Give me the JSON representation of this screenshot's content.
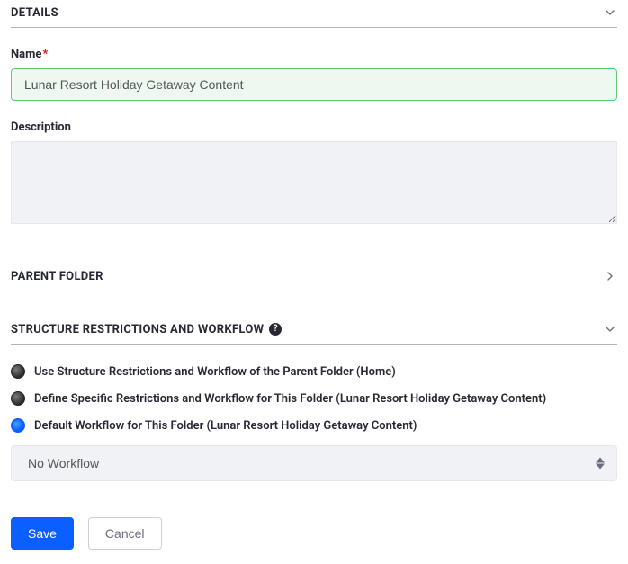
{
  "sections": {
    "details": {
      "title": "DETAILS",
      "expanded": true
    },
    "parent_folder": {
      "title": "PARENT FOLDER",
      "expanded": false
    },
    "structure_restrictions": {
      "title": "STRUCTURE RESTRICTIONS AND WORKFLOW",
      "expanded": true,
      "help": "?"
    }
  },
  "fields": {
    "name": {
      "label": "Name",
      "required_mark": "*",
      "value": "Lunar Resort Holiday Getaway Content"
    },
    "description": {
      "label": "Description",
      "value": ""
    }
  },
  "workflow": {
    "options": [
      {
        "label": "Use Structure Restrictions and Workflow of the Parent Folder (Home)",
        "selected": false
      },
      {
        "label": "Define Specific Restrictions and Workflow for This Folder (Lunar Resort Holiday Getaway Content)",
        "selected": false
      },
      {
        "label": "Default Workflow for This Folder (Lunar Resort Holiday Getaway Content)",
        "selected": true
      }
    ],
    "select_value": "No Workflow"
  },
  "buttons": {
    "save": "Save",
    "cancel": "Cancel"
  }
}
